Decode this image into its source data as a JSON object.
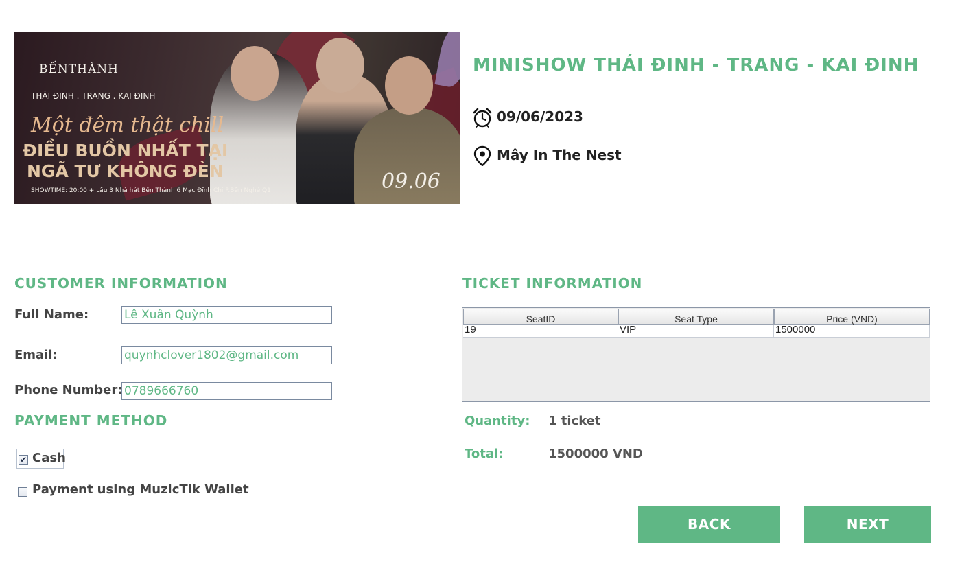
{
  "event": {
    "title": "MINISHOW THÁI ĐINH - TRANG - KAI ĐINH",
    "date": "09/06/2023",
    "venue": "Mây In The Nest",
    "poster": {
      "venue_logo": "BẾNTHÀNH",
      "artists_line": "THÁI ĐINH  .  TRANG  .  KAI ĐINH",
      "script_line": "Một đêm thật chill",
      "headline_1": "ĐIỀU BUỒN NHẤT TẠI",
      "headline_2": "NGÃ TƯ KHÔNG ĐÈN",
      "showtime": "SHOWTIME: 20:00  +  Lầu 3 Nhà hát Bến Thành 6 Mạc Đĩnh Chi P.Bến Nghé Q1",
      "date_badge": "09.06"
    }
  },
  "customer": {
    "heading": "CUSTOMER INFORMATION",
    "full_name_label": "Full Name:",
    "full_name": "Lê Xuân Quỳnh",
    "email_label": "Email:",
    "email": "quynhclover1802@gmail.com",
    "phone_label": "Phone Number:",
    "phone": "0789666760"
  },
  "payment": {
    "heading": "PAYMENT METHOD",
    "options": [
      {
        "label": "Cash",
        "checked": true
      },
      {
        "label": "Payment using MuzicTik Wallet",
        "checked": false
      }
    ]
  },
  "ticket": {
    "heading": "TICKET INFORMATION",
    "columns": [
      "SeatID",
      "Seat Type",
      "Price (VND)"
    ],
    "rows": [
      [
        "19",
        "VIP",
        "1500000"
      ]
    ],
    "quantity_label": "Quantity:",
    "quantity": "1 ticket",
    "total_label": "Total:",
    "total": "1500000 VND"
  },
  "buttons": {
    "back": "BACK",
    "next": "NEXT"
  },
  "icons": {
    "date": "alarm-clock-icon",
    "venue": "location-pin-icon"
  },
  "colors": {
    "accent": "#5fb785",
    "text_dark": "#222222"
  }
}
